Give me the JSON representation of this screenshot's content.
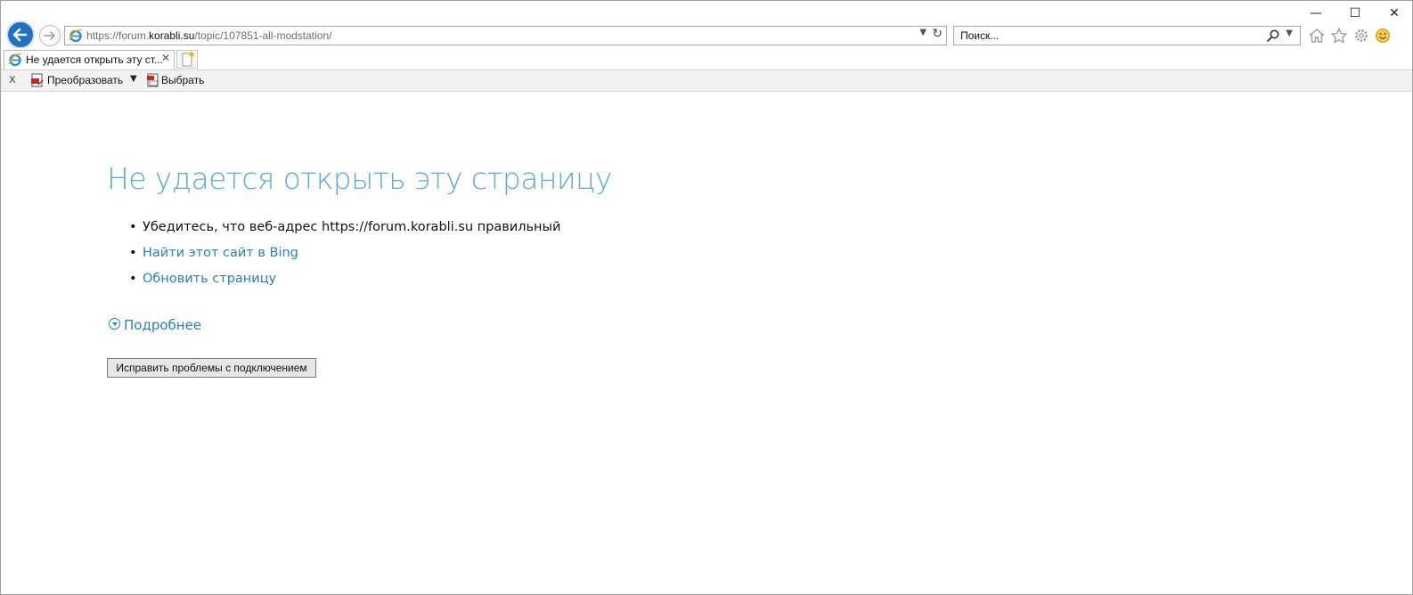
{
  "browser": {
    "address": {
      "url_prefix": "https://forum.",
      "url_host": "korabli.su",
      "url_path": "/topic/107851-all-modstation/"
    },
    "search": {
      "placeholder": "Поиск..."
    },
    "window_controls": {
      "minimize": "—",
      "maximize": "☐",
      "close": "✕"
    },
    "tab": {
      "title": "Не удается открыть эту ст...",
      "close": "✕"
    },
    "command_bar": {
      "close": "x",
      "convert_label": "Преобразовать",
      "select_label": "Выбрать"
    }
  },
  "page": {
    "heading": "Не удается открыть эту страницу",
    "tips": {
      "check_url": "Убедитесь, что веб-адрес https://forum.korabli.su правильный",
      "search_bing": "Найти этот сайт в Bing",
      "refresh": "Обновить страницу"
    },
    "details_label": "Подробнее",
    "fix_button": "Исправить проблемы с подключением"
  },
  "colors": {
    "heading": "#5fa8d8",
    "link": "#2a7fbf",
    "back_button": "#1e72c0"
  }
}
